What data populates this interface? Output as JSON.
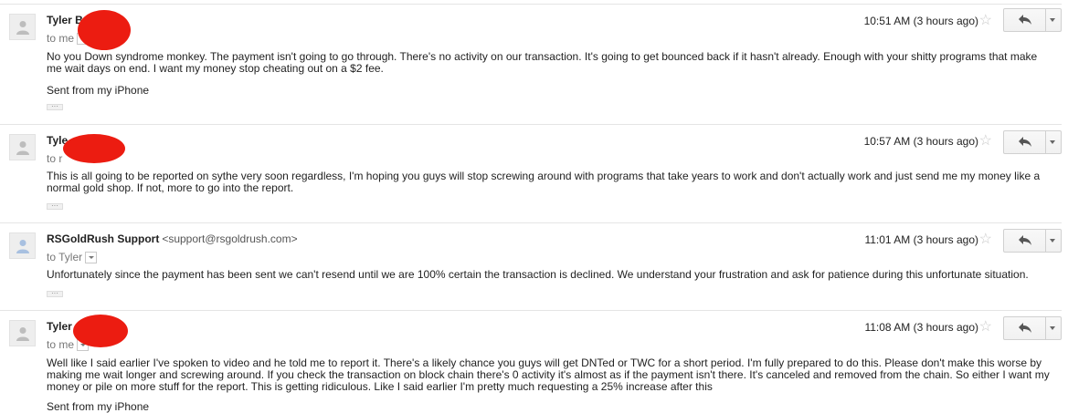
{
  "messages": [
    {
      "sender": "Tyler B",
      "email": "",
      "to": "to me",
      "time": "10:51 AM (3 hours ago)",
      "body": "No you Down syndrome monkey. The payment isn't going to go through. There's no activity on our transaction. It's going to get bounced back if it hasn't already. Enough with your shitty programs that make me wait days on end. I want my money stop cheating out on a $2 fee.",
      "signature": "Sent from my iPhone",
      "avatar_color": "#bdbdbd"
    },
    {
      "sender": "Tyle",
      "email": "",
      "to": "to r",
      "time": "10:57 AM (3 hours ago)",
      "body": "This is all going to be reported on sythe very soon regardless, I'm hoping you guys will stop screwing around with programs that take years to work and don't actually work and just send me my money like a normal gold shop. If not, more to go into the report.",
      "signature": "",
      "avatar_color": "#bdbdbd"
    },
    {
      "sender": "RSGoldRush Support",
      "email": "<support@rsgoldrush.com>",
      "to": "to Tyler",
      "time": "11:01 AM (3 hours ago)",
      "body": "Unfortunately since the payment has been sent we can't resend until we are 100% certain the transaction is declined. We understand your frustration and ask for patience during this unfortunate situation.",
      "signature": "",
      "avatar_color": "#a8c0e0"
    },
    {
      "sender": "Tyler",
      "email": "",
      "to": "to me",
      "time": "11:08 AM (3 hours ago)",
      "body": "Well like I said earlier I've spoken to video and he told me to report it. There's a likely chance you guys will get DNTed or TWC for a short period. I'm fully prepared to do this. Please don't make this worse by making me wait longer and screwing around. If you check the transaction on block chain there's 0 activity it's almost as if the payment isn't there. It's canceled and removed from the chain. So either I want my money or pile on more stuff for the report. This is getting ridiculous. Like I said earlier I'm pretty much requesting a 25% increase after this",
      "signature": "Sent from my iPhone",
      "avatar_color": "#bdbdbd"
    }
  ],
  "icons": {
    "star": "star-icon",
    "reply": "reply-arrow-icon",
    "more": "chevron-down-icon",
    "avatar": "person-icon"
  },
  "colors": {
    "redaction": "#ec1c11",
    "star_outline": "#c8c8c8"
  }
}
